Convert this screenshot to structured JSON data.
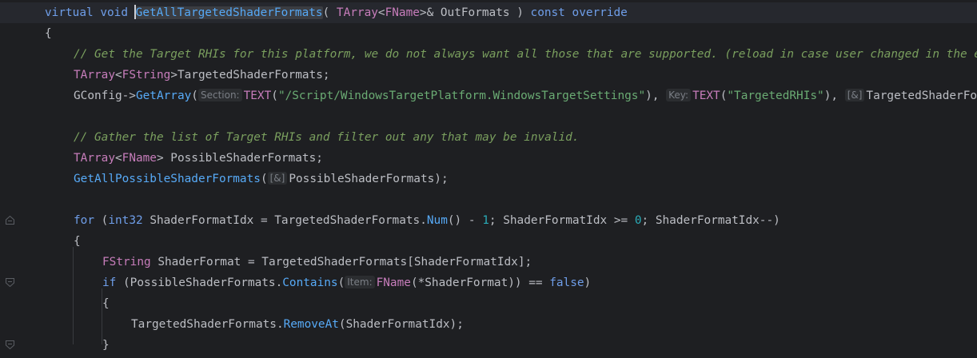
{
  "colors": {
    "background": "#1e1f22",
    "keyword": "#6f9ee9",
    "function": "#56a8f5",
    "type": "#c77dbb",
    "string": "#6aab73",
    "number": "#2aacb8",
    "comment": "#7a9f5e",
    "text": "#bcbec4",
    "inlay_hint": "#7a7e85"
  },
  "gutter": {
    "fold_markers": [
      {
        "icon": "fold-open-icon"
      },
      {
        "icon": "fold-close-icon"
      },
      {
        "icon": "fold-open-icon"
      },
      {
        "icon": "fold-open-icon"
      }
    ]
  },
  "editor": {
    "caret_line": 1,
    "lines": [
      {
        "tokens": [
          {
            "t": "virtual",
            "c": "kw"
          },
          {
            "t": " "
          },
          {
            "t": "void",
            "c": "kw"
          },
          {
            "t": " "
          },
          {
            "t": "",
            "c": "caret"
          },
          {
            "t": "GetAllTargetedShaderFormats",
            "c": "fn hl"
          },
          {
            "t": "( "
          },
          {
            "t": "TArray",
            "c": "type"
          },
          {
            "t": "<"
          },
          {
            "t": "FName",
            "c": "type"
          },
          {
            "t": ">& OutFormats ) "
          },
          {
            "t": "const",
            "c": "kw"
          },
          {
            "t": " "
          },
          {
            "t": "override",
            "c": "kw"
          }
        ]
      },
      {
        "tokens": [
          {
            "t": "{"
          }
        ]
      },
      {
        "tokens": [
          {
            "t": "// Get the Target RHIs for this platform, we do not always want all those that are supported. (reload in case user changed in the editor)",
            "c": "comment"
          }
        ]
      },
      {
        "tokens": [
          {
            "t": "TArray",
            "c": "type"
          },
          {
            "t": "<"
          },
          {
            "t": "FString",
            "c": "type"
          },
          {
            "t": ">TargetedShaderFormats;"
          }
        ]
      },
      {
        "tokens": [
          {
            "t": "GConfig->"
          },
          {
            "t": "GetArray",
            "c": "method"
          },
          {
            "t": "("
          },
          {
            "t": "Section:",
            "c": "hint"
          },
          {
            "t": "TEXT",
            "c": "type"
          },
          {
            "t": "("
          },
          {
            "t": "\"/Script/WindowsTargetPlatform.WindowsTargetSettings\"",
            "c": "str"
          },
          {
            "t": "), "
          },
          {
            "t": "Key:",
            "c": "hint"
          },
          {
            "t": "TEXT",
            "c": "type"
          },
          {
            "t": "("
          },
          {
            "t": "\"TargetedRHIs\"",
            "c": "str"
          },
          {
            "t": "), "
          },
          {
            "t": "[&]",
            "c": "hint"
          },
          {
            "t": "TargetedShaderFormats, GEngineIni);"
          }
        ]
      },
      {
        "tokens": []
      },
      {
        "tokens": [
          {
            "t": "// Gather the list of Target RHIs and filter out any that may be invalid.",
            "c": "comment"
          }
        ]
      },
      {
        "tokens": [
          {
            "t": "TArray",
            "c": "type"
          },
          {
            "t": "<"
          },
          {
            "t": "FName",
            "c": "type"
          },
          {
            "t": "> PossibleShaderFormats;"
          }
        ]
      },
      {
        "tokens": [
          {
            "t": "GetAllPossibleShaderFormats",
            "c": "method"
          },
          {
            "t": "("
          },
          {
            "t": "[&]",
            "c": "hint"
          },
          {
            "t": "PossibleShaderFormats);"
          }
        ]
      },
      {
        "tokens": []
      },
      {
        "tokens": [
          {
            "t": "for",
            "c": "kw"
          },
          {
            "t": " ("
          },
          {
            "t": "int32",
            "c": "kw"
          },
          {
            "t": " ShaderFormatIdx = TargetedShaderFormats."
          },
          {
            "t": "Num",
            "c": "method"
          },
          {
            "t": "() - "
          },
          {
            "t": "1",
            "c": "num"
          },
          {
            "t": "; ShaderFormatIdx >= "
          },
          {
            "t": "0",
            "c": "num"
          },
          {
            "t": "; ShaderFormatIdx--)"
          }
        ]
      },
      {
        "tokens": [
          {
            "t": "{"
          }
        ]
      },
      {
        "tokens": [
          {
            "t": "FString",
            "c": "type"
          },
          {
            "t": " ShaderFormat = TargetedShaderFormats[ShaderFormatIdx];"
          }
        ]
      },
      {
        "tokens": [
          {
            "t": "if",
            "c": "kw"
          },
          {
            "t": " (PossibleShaderFormats."
          },
          {
            "t": "Contains",
            "c": "method"
          },
          {
            "t": "("
          },
          {
            "t": "Item:",
            "c": "hint"
          },
          {
            "t": "FName",
            "c": "type"
          },
          {
            "t": "(*ShaderFormat)) == "
          },
          {
            "t": "false",
            "c": "kw"
          },
          {
            "t": ")"
          }
        ]
      },
      {
        "tokens": [
          {
            "t": "{"
          }
        ]
      },
      {
        "tokens": [
          {
            "t": "TargetedShaderFormats."
          },
          {
            "t": "RemoveAt",
            "c": "method"
          },
          {
            "t": "(ShaderFormatIdx);"
          }
        ]
      },
      {
        "tokens": [
          {
            "t": "}"
          }
        ]
      }
    ]
  }
}
